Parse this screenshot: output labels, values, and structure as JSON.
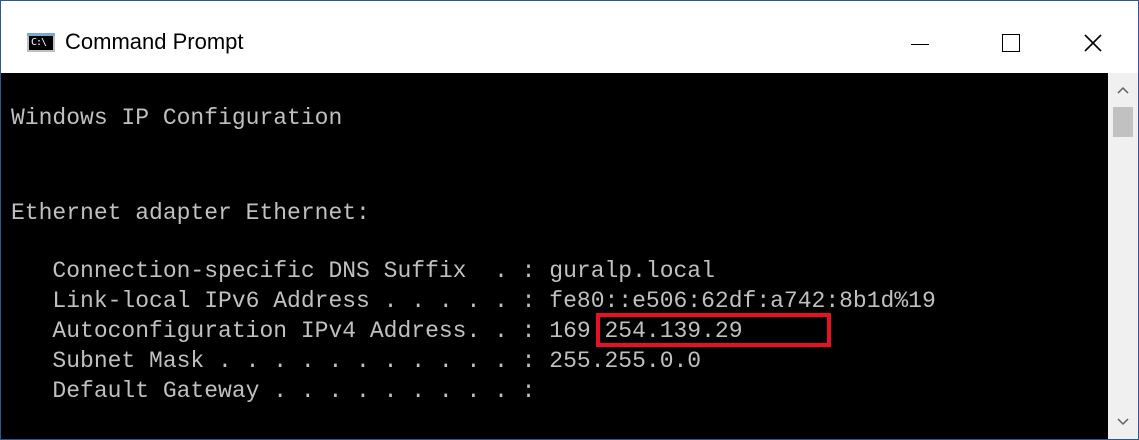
{
  "window": {
    "title": "Command Prompt",
    "icon": "C:\\"
  },
  "console": {
    "lines": [
      "Windows IP Configuration",
      "Ethernet adapter Ethernet:",
      "   Connection-specific DNS Suffix  . : guralp.local",
      "   Link-local IPv6 Address . . . . . : fe80::e506:62df:a742:8b1d%19",
      "   Autoconfiguration IPv4 Address. . : 169.254.139.29",
      "   Subnet Mask . . . . . . . . . . . : 255.255.0.0",
      "   Default Gateway . . . . . . . . . :"
    ]
  },
  "highlight_color": "#e81123"
}
